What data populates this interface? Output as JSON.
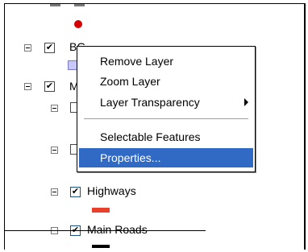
{
  "layers": {
    "bg": {
      "label": "BG",
      "checked": "✔"
    },
    "m": {
      "label": "M",
      "checked": "✔"
    },
    "highways": {
      "label": "Highways",
      "checked": "✔",
      "symbol_color": "#e8402a"
    },
    "main_roads": {
      "label": "Main Roads",
      "checked": "✔",
      "symbol_color": "#000000"
    },
    "top_point": {
      "symbol_color": "#d40000"
    }
  },
  "context_menu": {
    "items": [
      {
        "label": "Remove Layer"
      },
      {
        "label": "Zoom Layer"
      },
      {
        "label": "Layer Transparency",
        "submenu": true
      },
      {
        "label": "Selectable Features"
      },
      {
        "label": "Properties...",
        "selected": true
      }
    ]
  }
}
